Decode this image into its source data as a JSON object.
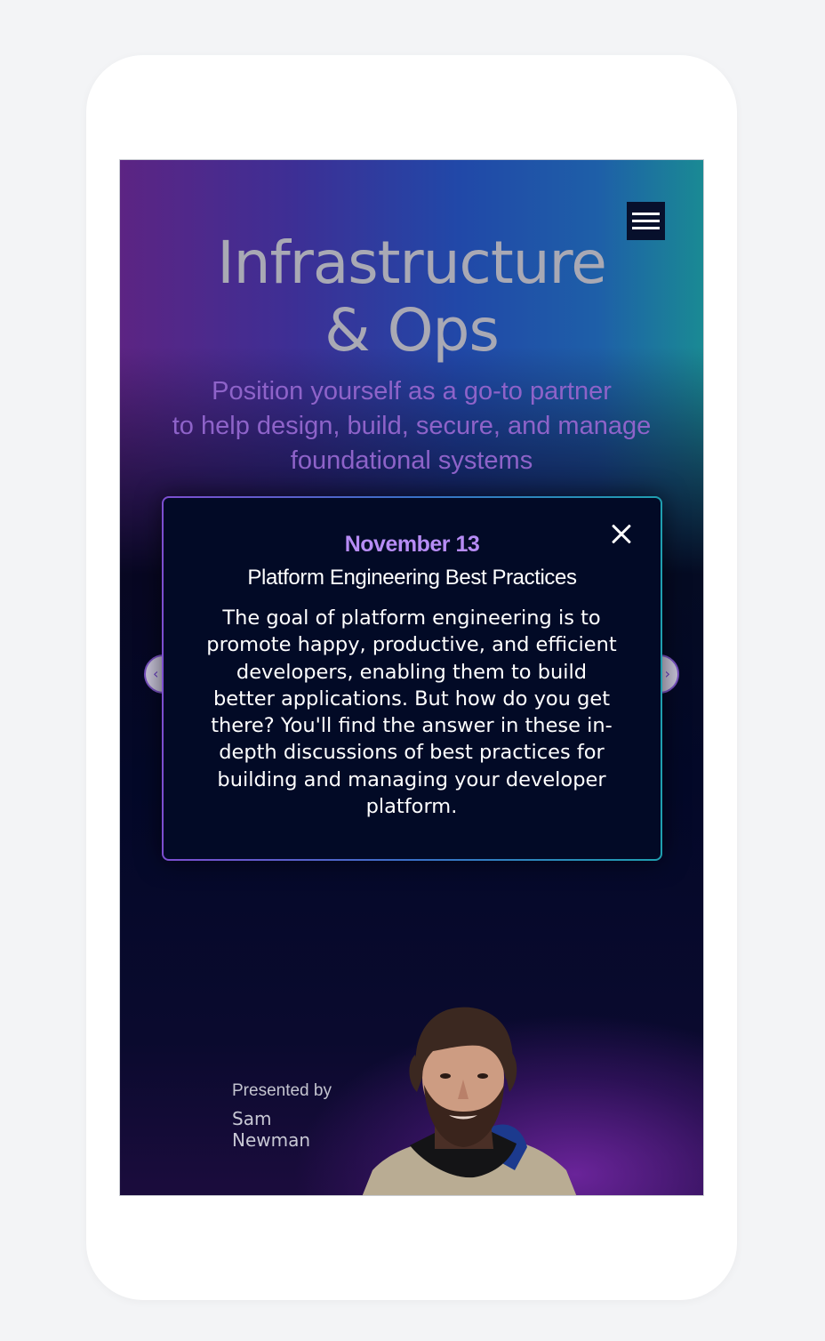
{
  "hero": {
    "title_line1": "Infrastructure",
    "title_line2": "& Ops",
    "subtitle_line1": "Position yourself as a go-to partner",
    "subtitle_line2": "to help design, build, secure, and manage",
    "subtitle_line3": "foundational systems"
  },
  "nav": {
    "menu_icon": "hamburger-menu-icon"
  },
  "carousel": {
    "prev_icon": "chevron-left-icon",
    "next_icon": "chevron-right-icon"
  },
  "modal": {
    "date": "November 13",
    "title": "Platform Engineering Best Practices",
    "description": "The goal of platform engineering is to promote happy, productive, and efficient developers, enabling them to build better applications. But how do you get there?  You'll find the answer in these in-depth discussions of best practices for building and managing your developer platform.",
    "close_icon": "close-icon"
  },
  "presenter": {
    "label": "Presented by",
    "name": "Sam Newman"
  },
  "colors": {
    "accent_purple": "#b78cf5",
    "subtitle_purple": "#8e63c9",
    "modal_background": "#020a26"
  }
}
